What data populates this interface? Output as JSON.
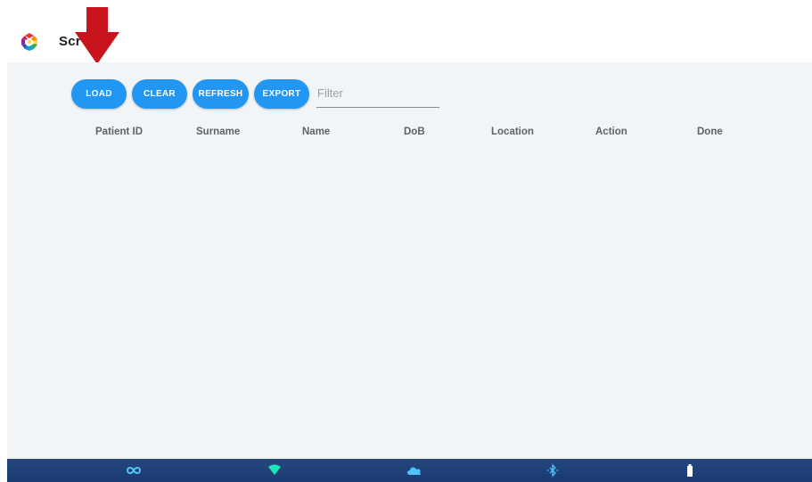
{
  "app": {
    "title": "Scr"
  },
  "toolbar": {
    "load_label": "LOAD",
    "clear_label": "CLEAR",
    "refresh_label": "REFRESH",
    "export_label": "EXPORT",
    "filter_placeholder": "Filter",
    "filter_value": ""
  },
  "table": {
    "columns": [
      "Patient ID",
      "Surname",
      "Name",
      "DoB",
      "Location",
      "Action",
      "Done"
    ],
    "rows": []
  },
  "status_bar": {
    "icons": [
      "infinity-icon",
      "wifi-icon",
      "cloud-icon",
      "bluetooth-icon",
      "battery-icon"
    ]
  },
  "colors": {
    "button": "#2196f3",
    "content_bg": "#f2f5f7",
    "status_bar": "#1f4078",
    "annotation_arrow": "#c8141c"
  }
}
